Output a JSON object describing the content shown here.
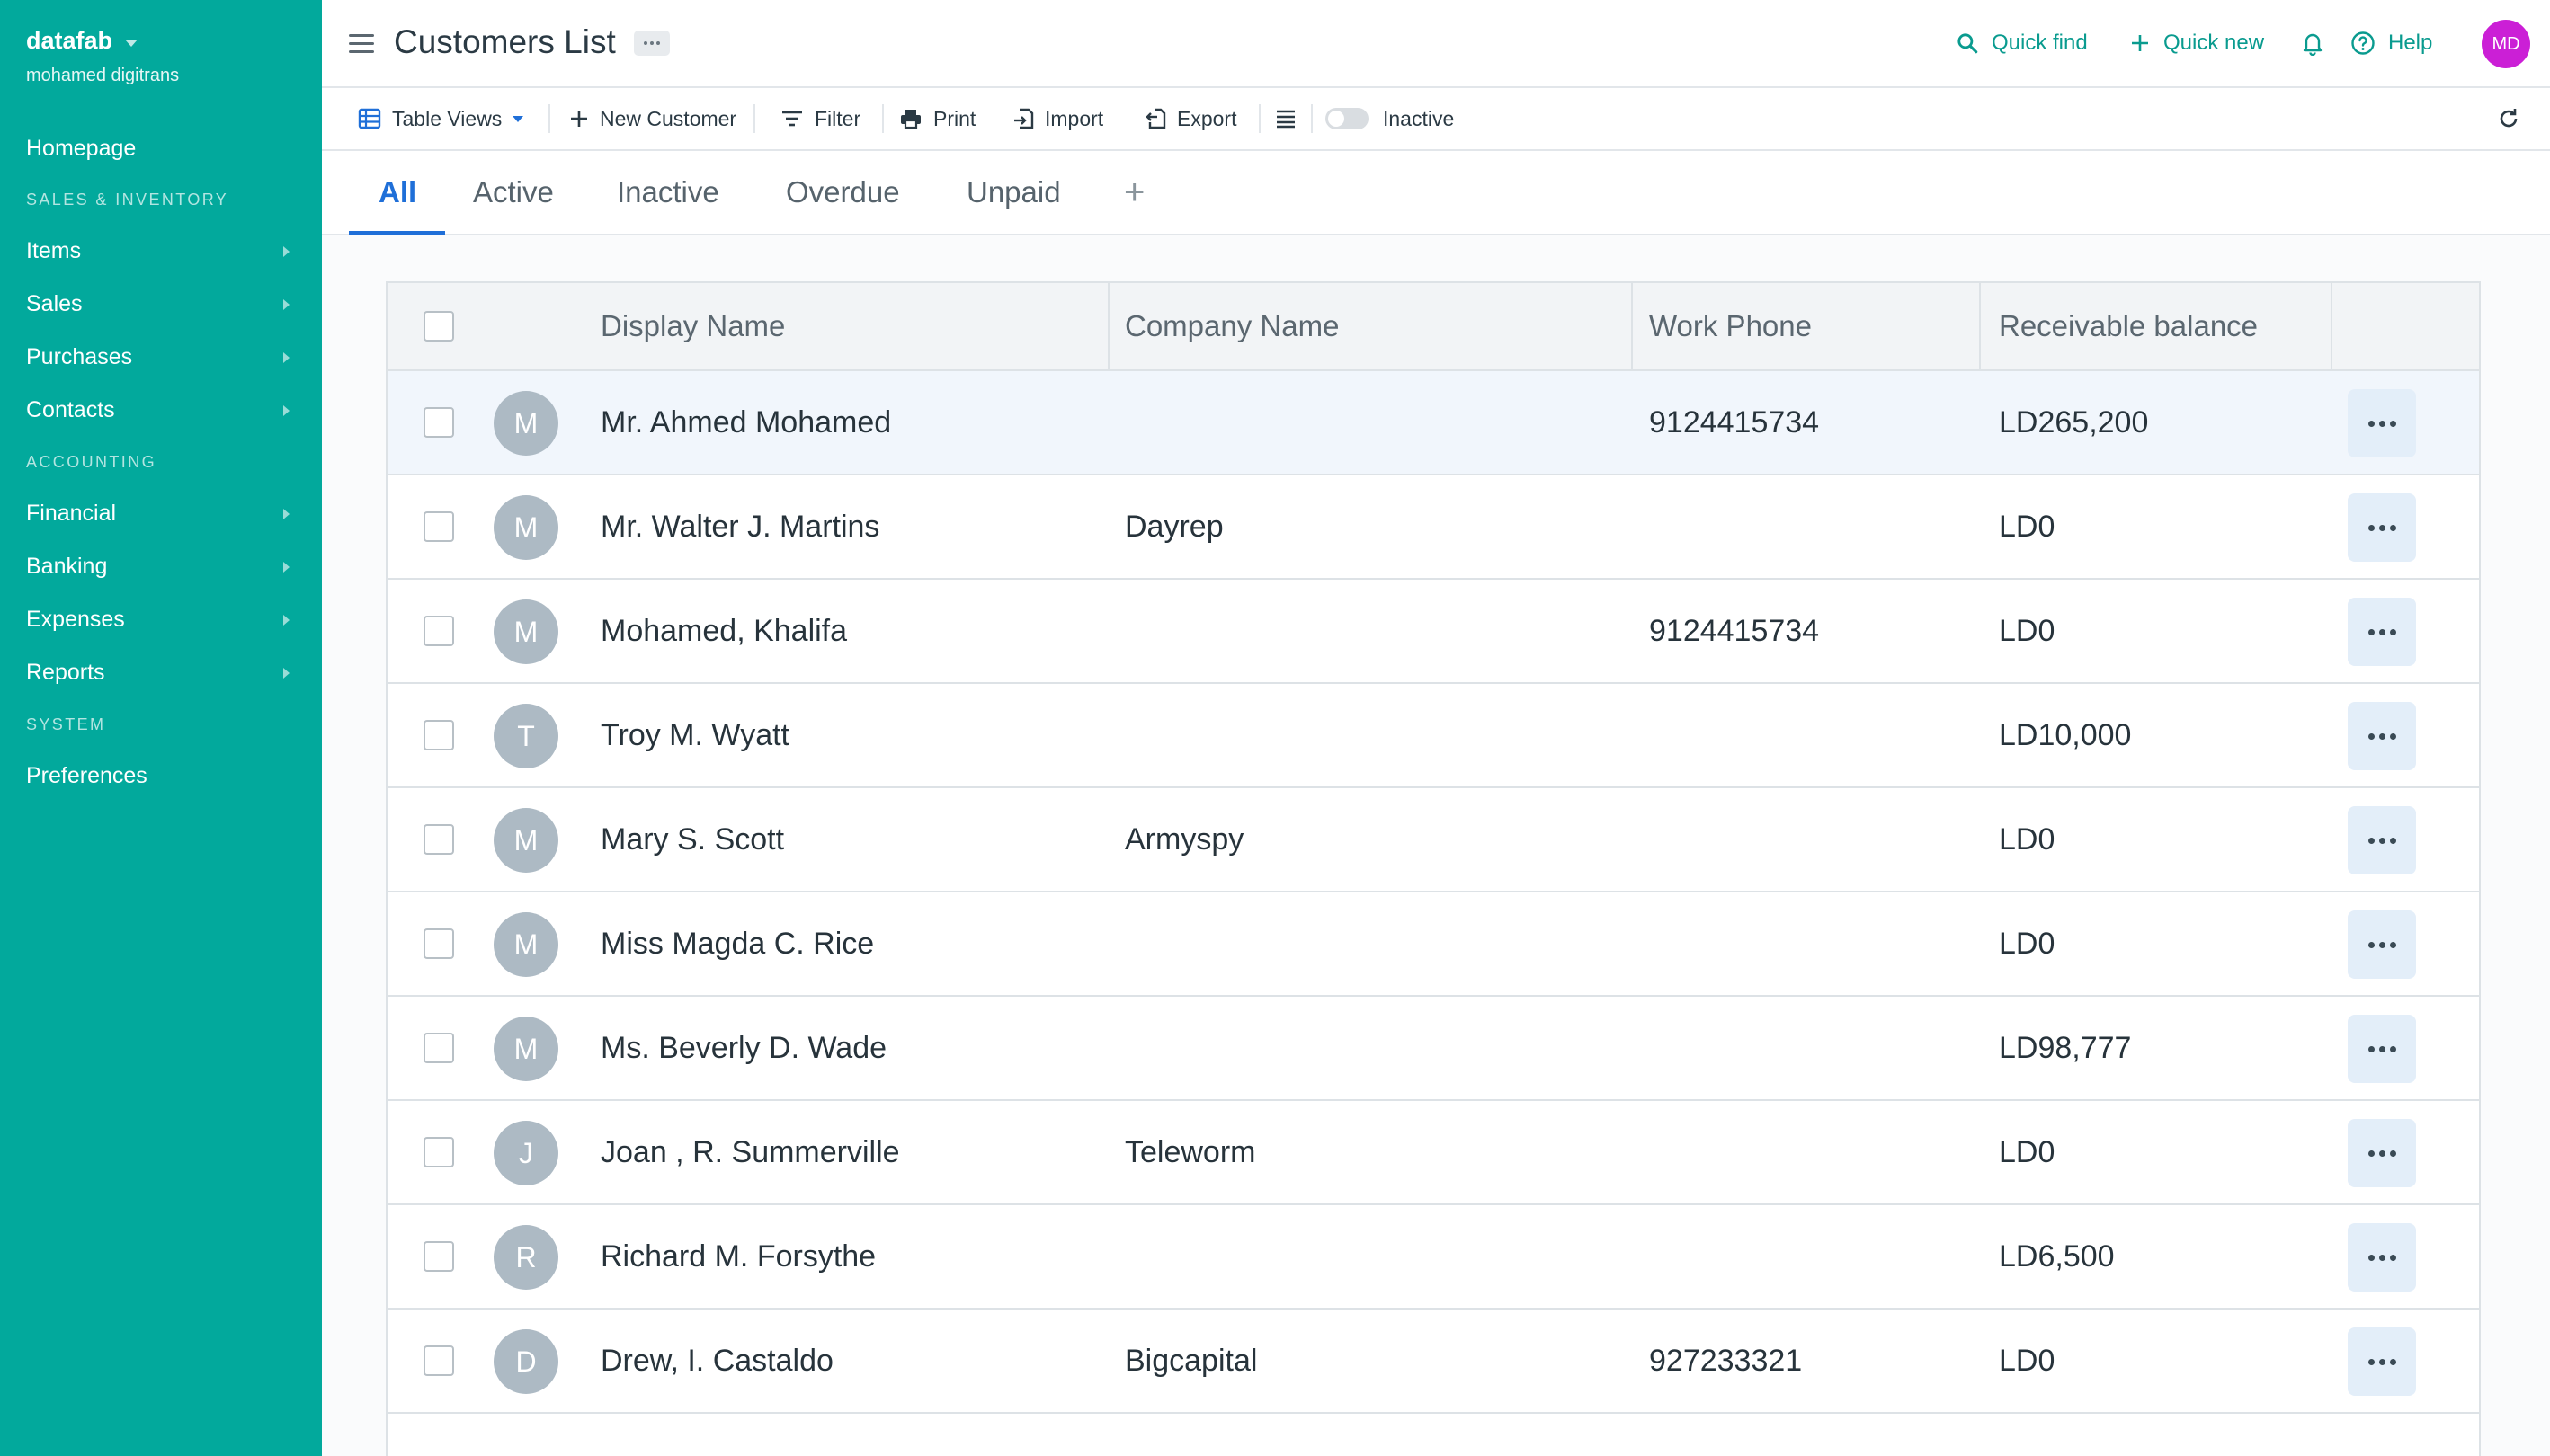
{
  "sidebar": {
    "org_name": "datafab",
    "org_user": "mohamed digitrans",
    "homepage": "Homepage",
    "sections": {
      "sales_inventory": "SALES & INVENTORY",
      "accounting": "ACCOUNTING",
      "system": "SYSTEM"
    },
    "items": {
      "items": "Items",
      "sales": "Sales",
      "purchases": "Purchases",
      "contacts": "Contacts",
      "financial": "Financial",
      "banking": "Banking",
      "expenses": "Expenses",
      "reports": "Reports",
      "preferences": "Preferences"
    }
  },
  "header": {
    "title": "Customers List",
    "quick_find": "Quick find",
    "quick_new": "Quick new",
    "help": "Help",
    "user_initials": "MD"
  },
  "toolbar": {
    "table_views": "Table Views",
    "new_customer": "New Customer",
    "filter": "Filter",
    "print": "Print",
    "import": "Import",
    "export": "Export",
    "inactive_toggle": "Inactive"
  },
  "tabs": [
    "All",
    "Active",
    "Inactive",
    "Overdue",
    "Unpaid"
  ],
  "table": {
    "columns": {
      "display_name": "Display Name",
      "company_name": "Company Name",
      "work_phone": "Work Phone",
      "receivable_balance": "Receivable balance"
    },
    "rows": [
      {
        "initial": "M",
        "name": "Mr. Ahmed Mohamed",
        "company": "",
        "phone": "9124415734",
        "balance": "LD265,200"
      },
      {
        "initial": "M",
        "name": "Mr. Walter J. Martins",
        "company": "Dayrep",
        "phone": "",
        "balance": "LD0"
      },
      {
        "initial": "M",
        "name": "Mohamed, Khalifa",
        "company": "",
        "phone": "9124415734",
        "balance": "LD0"
      },
      {
        "initial": "T",
        "name": "Troy M. Wyatt",
        "company": "",
        "phone": "",
        "balance": "LD10,000"
      },
      {
        "initial": "M",
        "name": "Mary S. Scott",
        "company": "Armyspy",
        "phone": "",
        "balance": "LD0"
      },
      {
        "initial": "M",
        "name": "Miss Magda C. Rice",
        "company": "",
        "phone": "",
        "balance": "LD0"
      },
      {
        "initial": "M",
        "name": "Ms. Beverly D. Wade",
        "company": "",
        "phone": "",
        "balance": "LD98,777"
      },
      {
        "initial": "J",
        "name": "Joan , R. Summerville",
        "company": "Teleworm",
        "phone": "",
        "balance": "LD0"
      },
      {
        "initial": "R",
        "name": "Richard M. Forsythe",
        "company": "",
        "phone": "",
        "balance": "LD6,500"
      },
      {
        "initial": "D",
        "name": "Drew, I. Castaldo",
        "company": "Bigcapital",
        "phone": "927233321",
        "balance": "LD0"
      }
    ]
  },
  "colors": {
    "sidebar_bg": "#02a99c",
    "accent_teal": "#0a9b8f",
    "accent_blue": "#1f6fd8",
    "avatar_gray": "#adbac4",
    "user_avatar": "#cb1fd6"
  },
  "icons": [
    "hamburger-icon",
    "more-icon",
    "search-icon",
    "plus-icon",
    "bell-icon",
    "help-icon",
    "table-icon",
    "filter-icon",
    "print-icon",
    "import-icon",
    "export-icon",
    "columns-icon",
    "refresh-icon"
  ]
}
